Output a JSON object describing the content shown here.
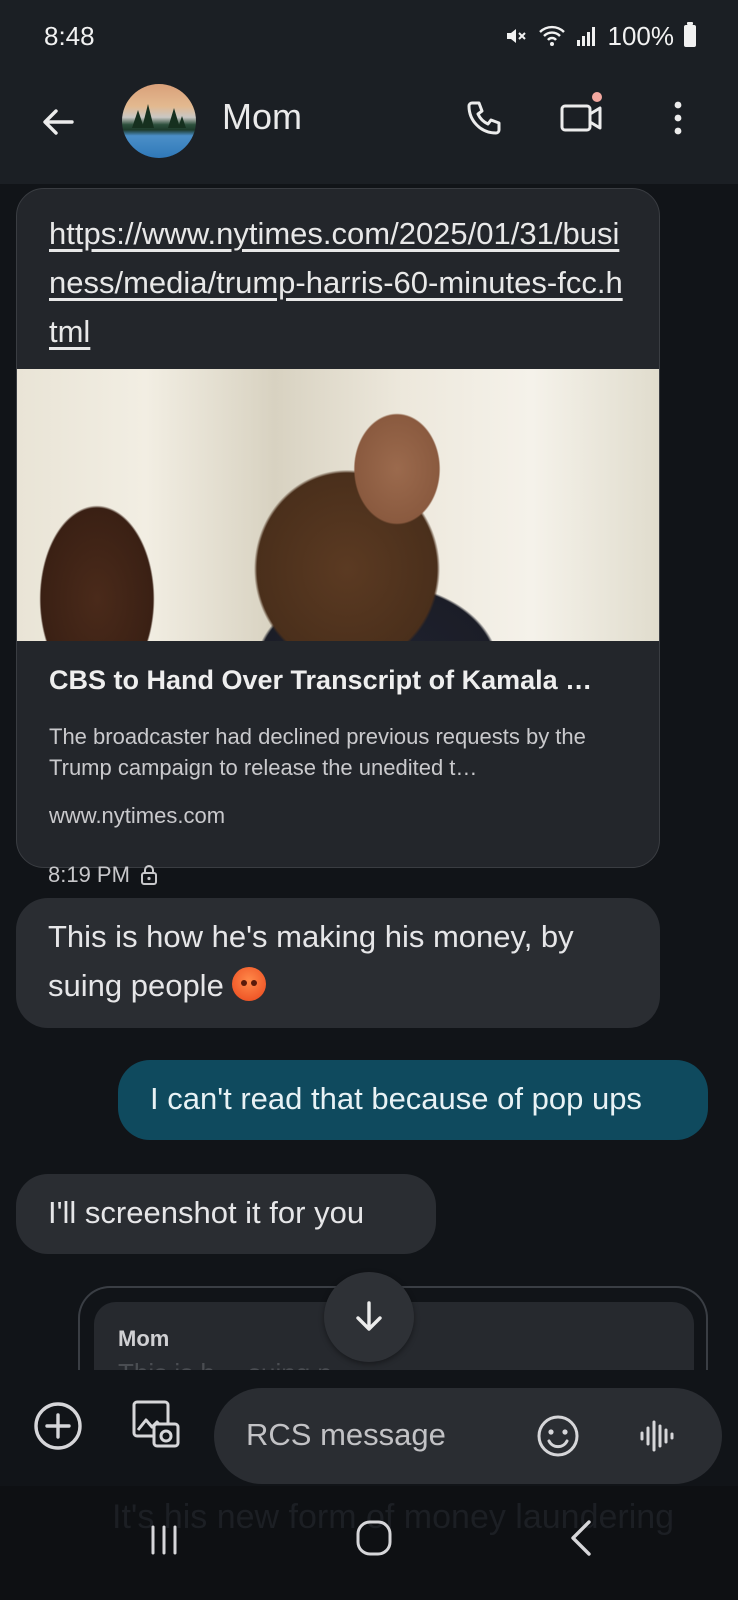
{
  "status_bar": {
    "time": "8:48",
    "battery": "100%"
  },
  "header": {
    "contact_name": "Mom"
  },
  "messages": {
    "link_preview": {
      "url": "https://www.nytimes.com/2025/01/31/business/media/trump-harris-60-minutes-fcc.html",
      "title": "CBS to Hand Over Transcript of Kamala …",
      "description": "The broadcaster had declined previous requests by the Trump campaign to release the unedited t…",
      "domain": "www.nytimes.com"
    },
    "timestamp": "8:19 PM",
    "incoming_1": "This is how he's making his money, by suing people",
    "outgoing_1": "I can't read that because of pop ups",
    "incoming_2": "I'll screenshot it for you",
    "reply_card": {
      "sender": "Mom",
      "preview": "This is h… suing p…"
    }
  },
  "compose": {
    "placeholder": "RCS message"
  },
  "background_ghost_text": "It's his new form of money laundering",
  "colors": {
    "outgoing_bubble": "#0f4a5e",
    "incoming_bubble": "#2a2d32",
    "background": "#111418"
  },
  "icons": [
    "back-arrow-icon",
    "phone-icon",
    "video-icon",
    "more-vert-icon",
    "lock-icon",
    "arrow-down-icon",
    "add-circle-icon",
    "gallery-icon",
    "emoji-icon",
    "voice-icon",
    "mute-icon",
    "wifi-icon",
    "signal-icon",
    "battery-icon"
  ]
}
